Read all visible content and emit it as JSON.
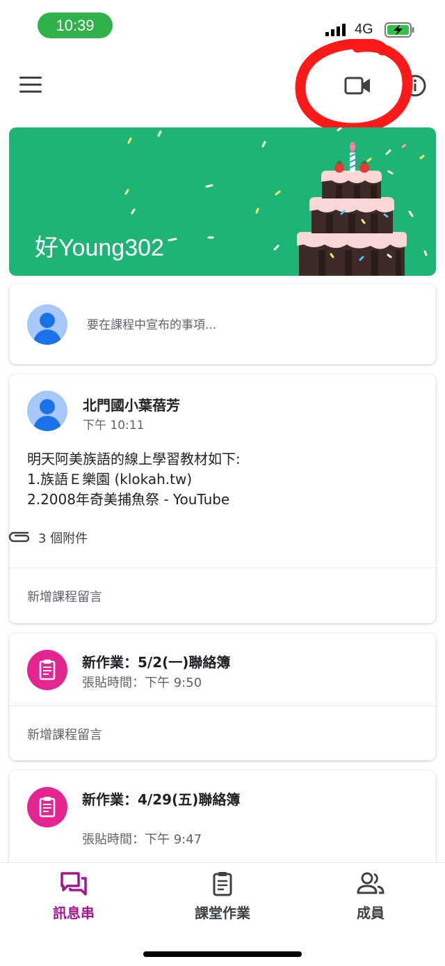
{
  "status_bar": {
    "time": "10:39",
    "network": "4G"
  },
  "course": {
    "title": "好Young302"
  },
  "composer": {
    "placeholder": "要在課程中宣布的事項..."
  },
  "announcement": {
    "author": "北門國小葉蓓芳",
    "time": "下午 10:11",
    "body": "明天阿美族語的線上學習教材如下:\n1.族語Ｅ樂園 (klokah.tw)\n2.2008年奇美捕魚祭 - YouTube",
    "attachments": "3 個附件",
    "comment_label": "新增課程留言"
  },
  "assignments": [
    {
      "title": "新作業：5/2(一)聯絡簿",
      "posted": "張貼時間：下午 9:50",
      "comment_label": "新增課程留言"
    },
    {
      "title": "新作業：4/29(五)聯絡簿",
      "posted": "張貼時間：下午 9:47"
    }
  ],
  "nav": {
    "items": [
      {
        "label": "訊息串",
        "icon": "stream-icon",
        "active": true
      },
      {
        "label": "課堂作業",
        "icon": "classwork-icon",
        "active": false
      },
      {
        "label": "成員",
        "icon": "people-icon",
        "active": false
      }
    ]
  },
  "colors": {
    "status_pill": "#30b24a",
    "banner": "#1eb475",
    "assignment_icon": "#e52592",
    "active_nav": "#a1178f",
    "annotation": "#ff0000"
  }
}
